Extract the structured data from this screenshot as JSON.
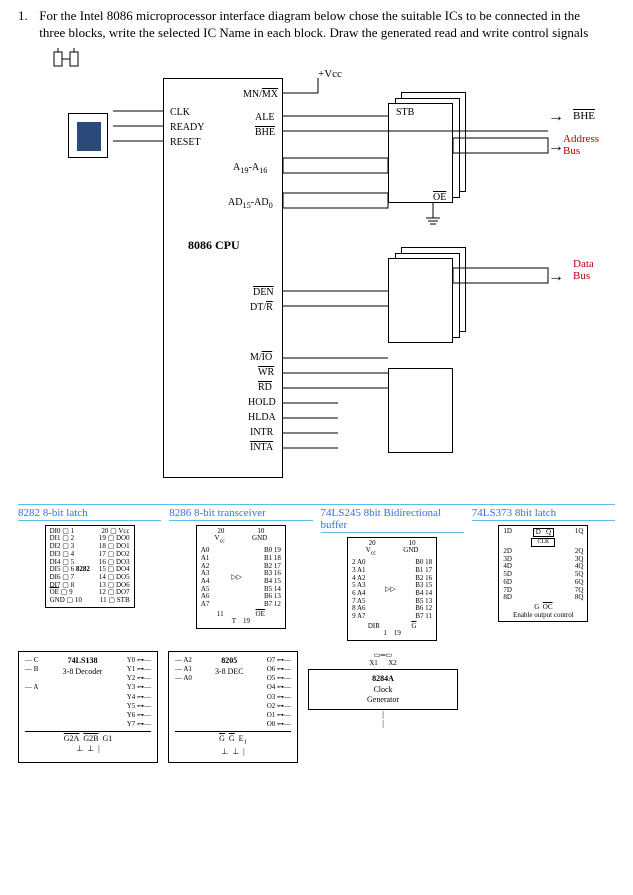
{
  "question": {
    "number": "1.",
    "text": "For the Intel 8086 microprocessor interface diagram below chose the suitable ICs to be connected in the three blocks, write the selected IC Name in each block. Draw the generated read and write control signals"
  },
  "vcc_label": "+Vcc",
  "cpu": {
    "clk": "CLK",
    "ready": "READY",
    "reset": "RESET",
    "mn_mx": "MN/MX",
    "ale": "ALE",
    "bhe": "BHE",
    "a19_a16": "A19-A16",
    "ad15_ad0": "AD15-AD0",
    "name": "8086 CPU",
    "den": "DEN",
    "dtr": "DT/R",
    "mio": "M/IO",
    "wr": "WR",
    "rd": "RD",
    "hold": "HOLD",
    "hlda": "HLDA",
    "intr": "INTR",
    "inta": "INTA"
  },
  "right": {
    "stb": "STB",
    "oe": "OE",
    "bhe_out": "BHE",
    "address_bus": "Address\nBus",
    "data_bus": "Data\nBus"
  },
  "ics": {
    "a": {
      "name": "8282 8-bit latch",
      "left_pins": [
        "DI0",
        "DI1",
        "DI2",
        "DI3",
        "DI4",
        "DI5",
        "DI6",
        "DI7",
        "OE",
        "GND"
      ],
      "right_pins": [
        "Vcc",
        "DO0",
        "DO1",
        "DO2",
        "DO3",
        "DO4",
        "DO5",
        "DO6",
        "DO7",
        "STB"
      ],
      "center": "8282"
    },
    "b": {
      "name": "8286 8-bit transceiver",
      "top_pins": [
        "20 Vcc",
        "10 GND"
      ],
      "left": [
        "A0",
        "A1",
        "A2",
        "A3",
        "A4",
        "A5",
        "A6",
        "A7"
      ],
      "right": [
        "B0",
        "B1",
        "B2",
        "B3",
        "B4",
        "B5",
        "B6",
        "B7"
      ],
      "bot": [
        "11 T",
        "19 OE"
      ]
    },
    "c": {
      "name": "74LS245 8bit Bidirectional buffer",
      "top": [
        "20 Vcc",
        "10 GND"
      ],
      "left": [
        "A0",
        "A1",
        "A2",
        "A3",
        "A4",
        "A5",
        "A6",
        "A7"
      ],
      "right": [
        "B0",
        "B1",
        "B2",
        "B3",
        "B4",
        "B5",
        "B6",
        "B7"
      ],
      "bot": [
        "DIR 1",
        "G 19"
      ]
    },
    "d": {
      "name": "74LS373 8bit latch",
      "pins_left": [
        "1D",
        "2D",
        "3D",
        "4D",
        "5D",
        "6D",
        "7D",
        "8D"
      ],
      "pins_right": [
        "1Q",
        "2Q",
        "3Q",
        "4Q",
        "5Q",
        "6Q",
        "7Q",
        "8Q"
      ],
      "ctrl": [
        "G",
        "OC"
      ],
      "label": "Enable output control",
      "clk": "CLK"
    }
  },
  "bottom": {
    "decoder": {
      "title": "74LS138",
      "sub": "3-8 Decoder",
      "inputs": [
        "C",
        "B",
        "A"
      ],
      "outputs": [
        "Y0",
        "Y1",
        "Y2",
        "Y3",
        "Y4",
        "Y5",
        "Y6",
        "Y7"
      ],
      "enables": [
        "G2A",
        "G2B",
        "G1"
      ]
    },
    "dec2": {
      "title": "8205",
      "sub": "3-8 DEC",
      "inputs": [
        "A2",
        "A1",
        "A0"
      ],
      "outputs": [
        "O7",
        "O6",
        "O5",
        "O4",
        "O3",
        "O2",
        "O1",
        "O0"
      ],
      "enables": [
        "G",
        "G",
        "E1"
      ]
    },
    "clock": {
      "title": "8284A",
      "sub1": "Clock",
      "sub2": "Generator",
      "crystals": [
        "X1",
        "X2"
      ]
    }
  }
}
